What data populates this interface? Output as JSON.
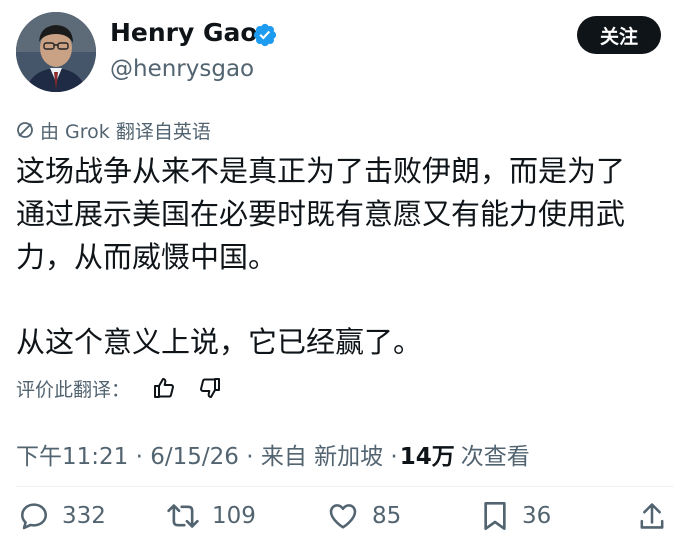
{
  "author": {
    "name": "Henry Gao",
    "handle": "@henrysgao",
    "verified_color": "#1d9bf0",
    "avatar": "avatar"
  },
  "follow_button": {
    "label": "关注"
  },
  "translation_notice": {
    "icon": "translate-icon",
    "text": "由 Grok 翻译自英语"
  },
  "post": {
    "paragraph1_lines": [
      "这场战争从来不是真正为了击败伊朗，而是为了",
      "通过展示美国在必要时既有意愿又有能力使用武",
      "力，从而威慑中国。"
    ],
    "paragraph2": "从这个意义上说，它已经赢了。"
  },
  "rating": {
    "label": "评价此翻译：",
    "thumbs_up_icon": "thumbs-up-icon",
    "thumbs_down_icon": "thumbs-down-icon"
  },
  "meta": {
    "time_date_source": "下午11:21 · 6/15/26 · 来自 新加坡 · ",
    "views_count": "14万",
    "views_label": "次查看"
  },
  "actions": {
    "replies": "332",
    "reposts": "109",
    "likes": "85",
    "bookmarks": "36"
  },
  "colors": {
    "text": "#0f1419",
    "secondary": "#536471",
    "accent": "#1d9bf0",
    "follow_bg": "#0f1419"
  }
}
